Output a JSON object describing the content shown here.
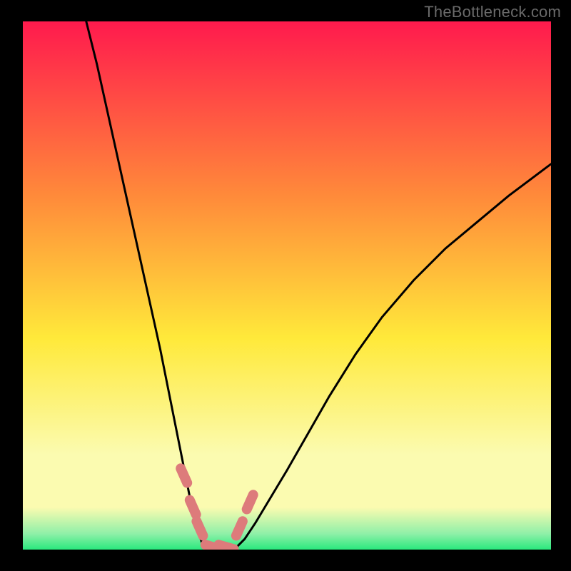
{
  "watermark": "TheBottleneck.com",
  "colors": {
    "bg_black": "#000000",
    "grad_top": "#ff1a4d",
    "grad_mid_orange": "#ff8a3a",
    "grad_yellow": "#ffe93a",
    "grad_pale_yellow": "#fbfbb0",
    "grad_green": "#2ae87d",
    "curve_stroke": "#000000",
    "peak_fill": "#dd7b7b"
  },
  "chart_data": {
    "type": "line",
    "title": "",
    "xlabel": "",
    "ylabel": "",
    "xlim": [
      0,
      100
    ],
    "ylim": [
      0,
      100
    ],
    "series": [
      {
        "name": "left-curve",
        "x": [
          12,
          14,
          16,
          18,
          20,
          22,
          24,
          26,
          28,
          30,
          32,
          33,
          34,
          35
        ],
        "values": [
          100,
          92,
          83,
          74,
          65,
          56,
          47,
          38,
          28,
          18,
          8,
          4,
          1,
          0
        ]
      },
      {
        "name": "right-curve",
        "x": [
          40,
          42,
          44,
          47,
          50,
          54,
          58,
          63,
          68,
          74,
          80,
          86,
          92,
          100
        ],
        "values": [
          0,
          2,
          5,
          10,
          15,
          22,
          29,
          37,
          44,
          51,
          57,
          62,
          67,
          73
        ]
      }
    ],
    "annotations": [
      {
        "name": "peak-marker-left-a",
        "x": 30.5,
        "y": 14
      },
      {
        "name": "peak-marker-left-b",
        "x": 32.2,
        "y": 8
      },
      {
        "name": "peak-marker-left-c",
        "x": 33.5,
        "y": 4
      },
      {
        "name": "peak-marker-valley",
        "x": 36,
        "y": 0.5
      },
      {
        "name": "peak-marker-valley2",
        "x": 38.5,
        "y": 0.5
      },
      {
        "name": "peak-marker-right-a",
        "x": 41,
        "y": 4
      },
      {
        "name": "peak-marker-right-b",
        "x": 43,
        "y": 9
      }
    ],
    "background_gradient_stops": [
      {
        "offset": 0.0,
        "color": "#ff1a4d"
      },
      {
        "offset": 0.33,
        "color": "#ff8a3a"
      },
      {
        "offset": 0.6,
        "color": "#ffe93a"
      },
      {
        "offset": 0.82,
        "color": "#fbfbb0"
      },
      {
        "offset": 0.92,
        "color": "#fbfbb0"
      },
      {
        "offset": 0.97,
        "color": "#8ff0a8"
      },
      {
        "offset": 1.0,
        "color": "#2ae87d"
      }
    ]
  }
}
